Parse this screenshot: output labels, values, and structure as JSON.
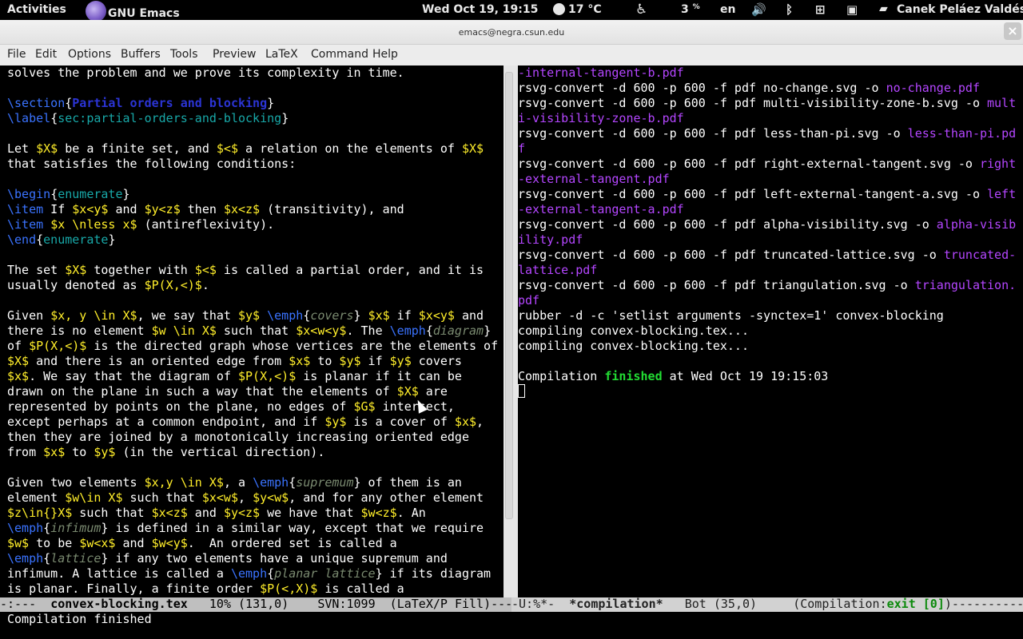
{
  "topbar": {
    "activities": "Activities",
    "app_name": "GNU Emacs",
    "clock": "Wed Oct 19, 19:15",
    "weather": "17 °C",
    "battery": "3",
    "battery_unit": "%",
    "language": "en",
    "user": "Canek Peláez Valdés"
  },
  "window": {
    "title": "emacs@negra.csun.edu",
    "close": "×"
  },
  "menu": [
    "File",
    "Edit",
    "Options",
    "Buffers",
    "Tools",
    "Preview",
    "LaTeX",
    "Command",
    "Help"
  ],
  "left": {
    "t0": "solves the problem and we prove its complexity in time.",
    "sec_cmd": "\\section",
    "sec_title": "Partial orders and blocking",
    "label_cmd": "\\label",
    "label_arg": "sec:partial-orders-and-blocking",
    "l_a": "Let ",
    "l_b": "$X$",
    "l_c": " be a finite set, and ",
    "l_d": "$<$",
    "l_e": " a relation on the elements of ",
    "l_f": "$X$",
    "t1": "that satisfies the following conditions:",
    "begin": "\\begin",
    "enum": "enumerate",
    "item": "\\item",
    "end": "\\end",
    "i1_a": " If ",
    "i1_b": "$x<y$",
    "i1_c": " and ",
    "i1_d": "$y<z$",
    "i1_e": " then ",
    "i1_f": "$x<z$",
    "i1_g": " (transitivity), and",
    "i2_a": " ",
    "i2_b": "$x \\nless x$",
    "i2_c": " (antireflexivity).",
    "p1_a": "The set ",
    "p1_b": "$X$",
    "p1_c": " together with ",
    "p1_d": "$<$",
    "p1_e": " is called a partial order, and it is",
    "p1b_a": "usually denoted as ",
    "p1b_b": "$P(X,<)$",
    "p1b_c": ".",
    "g1_a": "Given ",
    "g1_b": "$x, y \\in X$",
    "g1_c": ", we say that ",
    "g1_d": "$y$",
    "g1_e": " ",
    "g1_f": "\\emph",
    "g1_g": "covers",
    "g1_h": " ",
    "g1_i": "$x$",
    "g1_j": " if ",
    "g1_k": "$x<y$",
    "g1_l": " and",
    "g2_a": "there is no element ",
    "g2_b": "$w \\in X$",
    "g2_c": " such that ",
    "g2_d": "$x<w<y$",
    "g2_e": ". The ",
    "g2_f": "\\emph",
    "g2_g": "diagram",
    "g3_a": "of ",
    "g3_b": "$P(X,<)$",
    "g3_c": " is the directed graph whose vertices are the elements of",
    "g4_a": "$X$",
    "g4_b": " and there is an oriented edge from ",
    "g4_c": "$x$",
    "g4_d": " to ",
    "g4_e": "$y$",
    "g4_f": " if ",
    "g4_g": "$y$",
    "g4_h": " covers",
    "g5_a": "$x$",
    "g5_b": ". We say that the diagram of ",
    "g5_c": "$P(X,<)$",
    "g5_d": " is planar if it can be",
    "g6_a": "drawn on the plane in such a way that the elements of ",
    "g6_b": "$X$",
    "g6_c": " are",
    "g7_a": "represented by points on the plane, no edges of ",
    "g7_b": "$G$",
    "g7_c": " intersect,",
    "g8_a": "except perhaps at a common endpoint, and if ",
    "g8_b": "$y$",
    "g8_c": " is a cover of ",
    "g8_d": "$x$",
    "g8_e": ",",
    "g9": "then they are joined by a monotonically increasing oriented edge",
    "g10_a": "from ",
    "g10_b": "$x$",
    "g10_c": " to ",
    "g10_d": "$y$",
    "g10_e": " (in the vertical direction).",
    "h1_a": "Given two elements ",
    "h1_b": "$x,y \\in X$",
    "h1_c": ", a ",
    "h1_d": "\\emph",
    "h1_e": "supremum",
    "h1_f": " of them is an",
    "h2_a": "element ",
    "h2_b": "$w\\in X$",
    "h2_c": " such that ",
    "h2_d": "$x<w$",
    "h2_e": ", ",
    "h2_f": "$y<w$",
    "h2_g": ", and for any other element",
    "h3_a": "$z\\in{}X$",
    "h3_b": " such that ",
    "h3_c": "$x<z$",
    "h3_d": " and ",
    "h3_e": "$y<z$",
    "h3_f": " we have that ",
    "h3_g": "$w<z$",
    "h3_h": ". An",
    "h4_a": "\\emph",
    "h4_b": "infimum",
    "h4_c": " is defined in a similar way, except that we require",
    "h5_a": "$w$",
    "h5_b": " to be ",
    "h5_c": "$w<x$",
    "h5_d": " and ",
    "h5_e": "$w<y$",
    "h5_f": ".  An ordered set is called a",
    "h6_a": "\\emph",
    "h6_b": "lattice",
    "h6_c": " if any two elements have a unique supremum and",
    "h7_a": "infimum. A lattice is called a ",
    "h7_b": "\\emph",
    "h7_c": "planar lattice",
    "h7_d": " if its diagram",
    "h8_a": "is planar. Finally, a finite order ",
    "h8_b": "$P(<,X)$",
    "h8_c": " is called a"
  },
  "right": {
    "r1": "-internal-tangent-b.pdf",
    "r2_a": "rsvg-convert -d 600 -p 600 -f pdf no-change.svg -o ",
    "r2_b": "no-change.pdf",
    "r3_a": "rsvg-convert -d 600 -p 600 -f pdf multi-visibility-zone-b.svg -o ",
    "r3_b": "mult",
    "r4": "i-visibility-zone-b.pdf",
    "r5_a": "rsvg-convert -d 600 -p 600 -f pdf less-than-pi.svg -o ",
    "r5_b": "less-than-pi.pd",
    "r6": "f",
    "r7_a": "rsvg-convert -d 600 -p 600 -f pdf right-external-tangent.svg -o ",
    "r7_b": "right",
    "r8": "-external-tangent.pdf",
    "r9_a": "rsvg-convert -d 600 -p 600 -f pdf left-external-tangent-a.svg -o ",
    "r9_b": "left",
    "r10": "-external-tangent-a.pdf",
    "r11_a": "rsvg-convert -d 600 -p 600 -f pdf alpha-visibility.svg -o ",
    "r11_b": "alpha-visib",
    "r12": "ility.pdf",
    "r13_a": "rsvg-convert -d 600 -p 600 -f pdf truncated-lattice.svg -o ",
    "r13_b": "truncated-",
    "r14": "lattice.pdf",
    "r15_a": "rsvg-convert -d 600 -p 600 -f pdf triangulation.svg -o ",
    "r15_b": "triangulation.",
    "r16": "pdf",
    "r17": "rubber -d -c 'setlist arguments -synctex=1' convex-blocking",
    "r18": "compiling convex-blocking.tex...",
    "r19": "compiling convex-blocking.tex...",
    "r20_a": "Compilation ",
    "r20_b": "finished",
    "r20_c": " at Wed Oct 19 19:15:03"
  },
  "modeline_left": {
    "prefix": "-:---  ",
    "buffer": "convex-blocking.tex",
    "pos": "   10% (131,0)    SVN:1099  (LaTeX/P Fill)-----"
  },
  "modeline_right": {
    "prefix": "-U:%*-  ",
    "buffer": "*compilation*",
    "pos": "   Bot (35,0)     (Compilation:",
    "status": "exit [0]",
    "suffix": ")----------"
  },
  "minibuffer": "Compilation finished",
  "colors": {
    "keyword": "#3a73ff",
    "math": "#ffee2a",
    "label": "#18a8a8",
    "file": "#b446ff",
    "success": "#22dd33"
  }
}
